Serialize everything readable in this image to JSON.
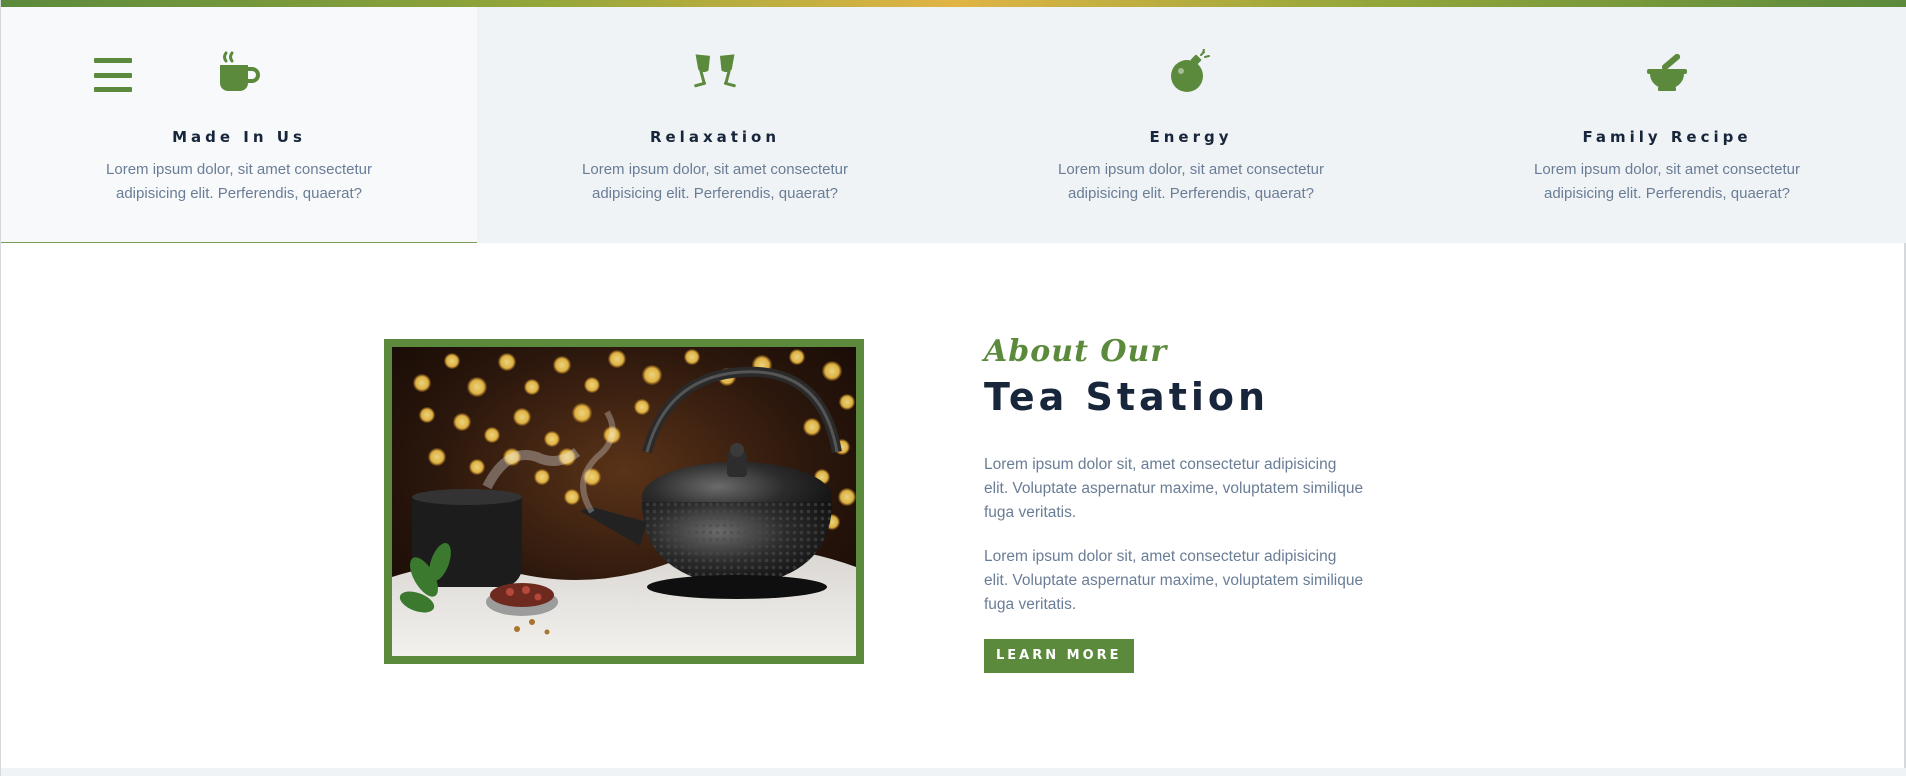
{
  "brand": {
    "accent": "#5b8a3c",
    "dark": "#17263a",
    "muted": "#6a7d96",
    "gold": "#e0b445"
  },
  "nav": {
    "menu_icon": "hamburger-menu-icon"
  },
  "services": [
    {
      "icon": "coffee-cup-icon",
      "title": "Made In Us",
      "text": "Lorem ipsum dolor, sit amet consectetur adipisicing elit. Perferendis, quaerat?"
    },
    {
      "icon": "toasting-glasses-icon",
      "title": "Relaxation",
      "text": "Lorem ipsum dolor, sit amet consectetur adipisicing elit. Perferendis, quaerat?"
    },
    {
      "icon": "bomb-icon",
      "title": "Energy",
      "text": "Lorem ipsum dolor, sit amet consectetur adipisicing elit. Perferendis, quaerat?"
    },
    {
      "icon": "mortar-pestle-icon",
      "title": "Family Recipe",
      "text": "Lorem ipsum dolor, sit amet consectetur adipisicing elit. Perferendis, quaerat?"
    }
  ],
  "about": {
    "script_title": "About Our",
    "title": "Tea Station",
    "paragraphs": [
      "Lorem ipsum dolor sit, amet consectetur adipisicing elit. Voluptate aspernatur maxime, voluptatem similique fuga veritatis.",
      "Lorem ipsum dolor sit, amet consectetur adipisicing elit. Voluptate aspernatur maxime, voluptatem similique fuga veritatis."
    ],
    "button_label": "LEARN MORE",
    "image_subject": "iron-teapot-photo"
  }
}
